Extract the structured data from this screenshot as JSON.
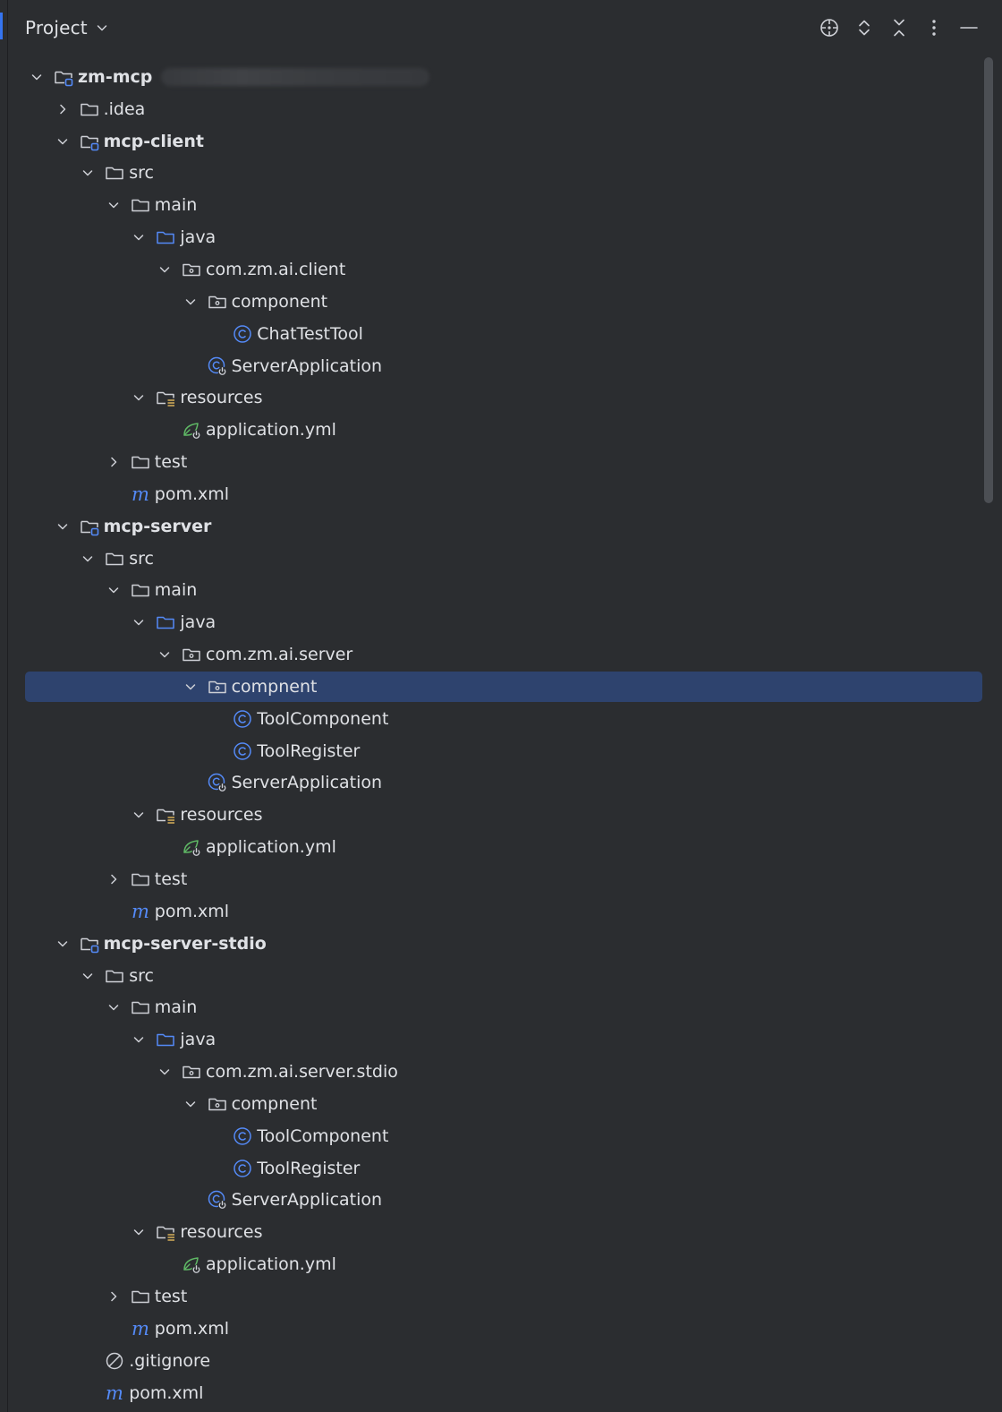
{
  "header": {
    "title": "Project",
    "title_dropdown_icon": "chevron-down-icon",
    "toolbar": [
      {
        "name": "select-opened-file-button",
        "icon": "crosshair-icon"
      },
      {
        "name": "expand-all-button",
        "icon": "expand-all-icon"
      },
      {
        "name": "collapse-all-button",
        "icon": "collapse-all-icon"
      },
      {
        "name": "options-button",
        "icon": "more-vertical-icon"
      },
      {
        "name": "hide-button",
        "icon": "minimize-icon"
      }
    ]
  },
  "tree": [
    {
      "label": "zm-mcp",
      "depth": 0,
      "icon": "module-folder-icon",
      "bold": true,
      "expanded": true,
      "redacted_path": true
    },
    {
      "label": ".idea",
      "depth": 1,
      "icon": "folder-icon",
      "expanded": false
    },
    {
      "label": "mcp-client",
      "depth": 1,
      "icon": "module-folder-icon",
      "bold": true,
      "expanded": true
    },
    {
      "label": "src",
      "depth": 2,
      "icon": "folder-icon",
      "expanded": true
    },
    {
      "label": "main",
      "depth": 3,
      "icon": "folder-icon",
      "expanded": true
    },
    {
      "label": "java",
      "depth": 4,
      "icon": "source-folder-icon",
      "expanded": true
    },
    {
      "label": "com.zm.ai.client",
      "depth": 5,
      "icon": "package-icon",
      "expanded": true
    },
    {
      "label": "component",
      "depth": 6,
      "icon": "package-icon",
      "expanded": true
    },
    {
      "label": "ChatTestTool",
      "depth": 7,
      "icon": "java-class-icon"
    },
    {
      "label": "ServerApplication",
      "depth": 6,
      "icon": "spring-boot-class-icon"
    },
    {
      "label": "resources",
      "depth": 4,
      "icon": "resources-folder-icon",
      "expanded": true
    },
    {
      "label": "application.yml",
      "depth": 5,
      "icon": "spring-config-icon"
    },
    {
      "label": "test",
      "depth": 3,
      "icon": "folder-icon",
      "expanded": false
    },
    {
      "label": "pom.xml",
      "depth": 3,
      "icon": "maven-icon"
    },
    {
      "label": "mcp-server",
      "depth": 1,
      "icon": "module-folder-icon",
      "bold": true,
      "expanded": true
    },
    {
      "label": "src",
      "depth": 2,
      "icon": "folder-icon",
      "expanded": true
    },
    {
      "label": "main",
      "depth": 3,
      "icon": "folder-icon",
      "expanded": true
    },
    {
      "label": "java",
      "depth": 4,
      "icon": "source-folder-icon",
      "expanded": true
    },
    {
      "label": "com.zm.ai.server",
      "depth": 5,
      "icon": "package-icon",
      "expanded": true
    },
    {
      "label": "compnent",
      "depth": 6,
      "icon": "package-icon",
      "expanded": true,
      "selected": true
    },
    {
      "label": "ToolComponent",
      "depth": 7,
      "icon": "java-class-icon"
    },
    {
      "label": "ToolRegister",
      "depth": 7,
      "icon": "java-class-icon"
    },
    {
      "label": "ServerApplication",
      "depth": 6,
      "icon": "spring-boot-class-icon"
    },
    {
      "label": "resources",
      "depth": 4,
      "icon": "resources-folder-icon",
      "expanded": true
    },
    {
      "label": "application.yml",
      "depth": 5,
      "icon": "spring-config-icon"
    },
    {
      "label": "test",
      "depth": 3,
      "icon": "folder-icon",
      "expanded": false
    },
    {
      "label": "pom.xml",
      "depth": 3,
      "icon": "maven-icon"
    },
    {
      "label": "mcp-server-stdio",
      "depth": 1,
      "icon": "module-folder-icon",
      "bold": true,
      "expanded": true
    },
    {
      "label": "src",
      "depth": 2,
      "icon": "folder-icon",
      "expanded": true
    },
    {
      "label": "main",
      "depth": 3,
      "icon": "folder-icon",
      "expanded": true
    },
    {
      "label": "java",
      "depth": 4,
      "icon": "source-folder-icon",
      "expanded": true
    },
    {
      "label": "com.zm.ai.server.stdio",
      "depth": 5,
      "icon": "package-icon",
      "expanded": true
    },
    {
      "label": "compnent",
      "depth": 6,
      "icon": "package-icon",
      "expanded": true
    },
    {
      "label": "ToolComponent",
      "depth": 7,
      "icon": "java-class-icon"
    },
    {
      "label": "ToolRegister",
      "depth": 7,
      "icon": "java-class-icon"
    },
    {
      "label": "ServerApplication",
      "depth": 6,
      "icon": "spring-boot-class-icon"
    },
    {
      "label": "resources",
      "depth": 4,
      "icon": "resources-folder-icon",
      "expanded": true
    },
    {
      "label": "application.yml",
      "depth": 5,
      "icon": "spring-config-icon"
    },
    {
      "label": "test",
      "depth": 3,
      "icon": "folder-icon",
      "expanded": false
    },
    {
      "label": "pom.xml",
      "depth": 3,
      "icon": "maven-icon"
    },
    {
      "label": ".gitignore",
      "depth": 2,
      "icon": "ignored-file-icon"
    },
    {
      "label": "pom.xml",
      "depth": 2,
      "icon": "maven-icon"
    }
  ],
  "colors": {
    "background": "#2b2d30",
    "selection": "#2e436e",
    "text": "#dfe1e5",
    "icon_gray": "#ced0d6",
    "icon_blue": "#548af7",
    "spring_green": "#5fb865",
    "resources_yellow": "#d6ae58"
  }
}
